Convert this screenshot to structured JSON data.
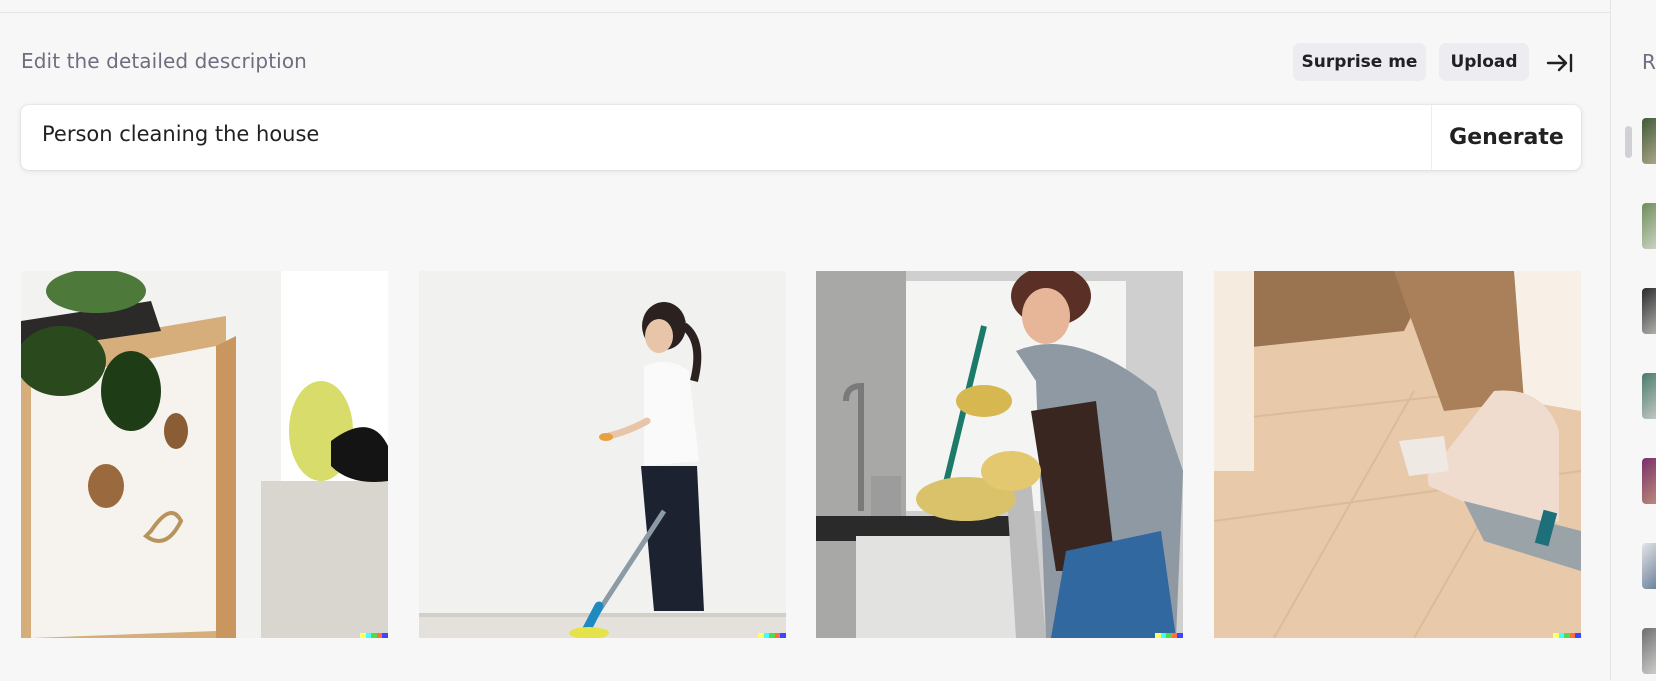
{
  "editor": {
    "label": "Edit the detailed description",
    "surprise_label": "Surprise me",
    "upload_label": "Upload",
    "collapse_icon": "arrow-right-to-bar-icon",
    "prompt_value": "Person cleaning the house",
    "generate_label": "Generate"
  },
  "results": [
    {
      "name": "cleaning-shelf-with-yellow-cloth"
    },
    {
      "name": "woman-mopping-wall"
    },
    {
      "name": "woman-cleaning-kitchen"
    },
    {
      "name": "hand-vacuuming-floor"
    }
  ],
  "history": {
    "title": "R",
    "thumbnail_count": 7
  },
  "colors": {
    "background": "#f7f7f8",
    "pill": "#ececf1",
    "text": "#202123",
    "muted": "#6e6e80",
    "signature": [
      "#ffff66",
      "#42ffff",
      "#51da4c",
      "#ff6e3c",
      "#3c46ff"
    ]
  }
}
